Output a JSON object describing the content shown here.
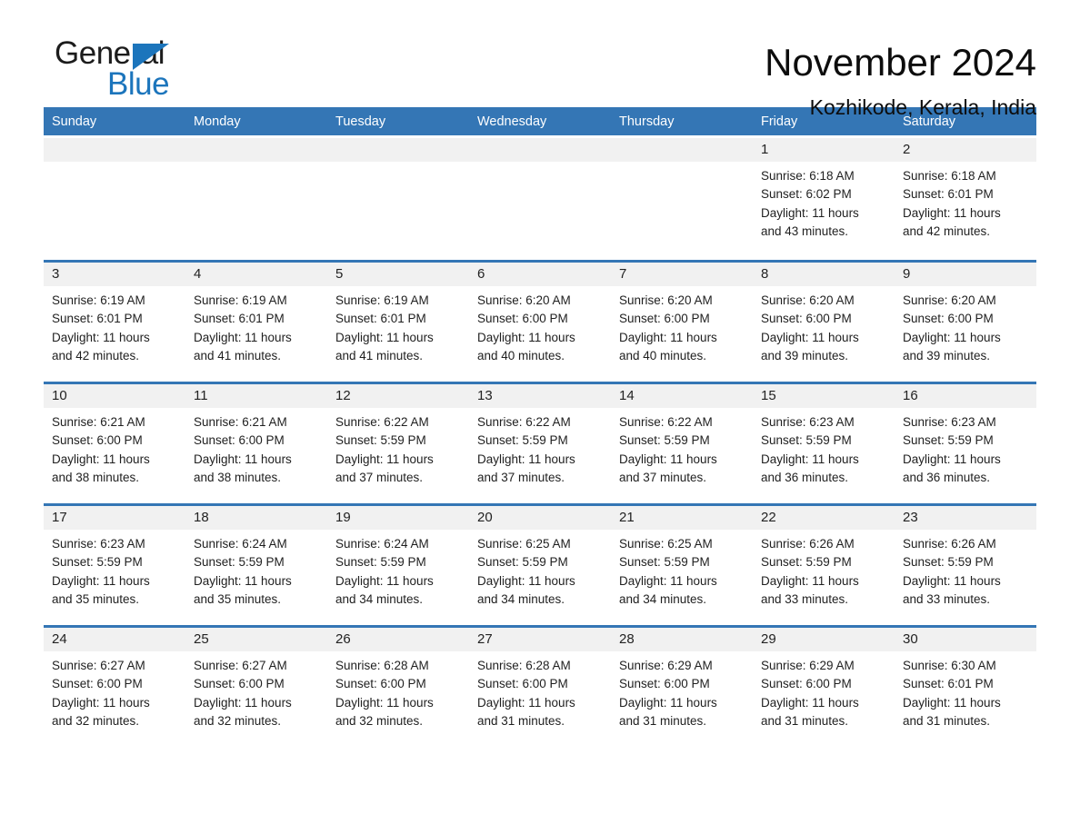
{
  "brand": {
    "name_part1": "General",
    "name_part2": "Blue",
    "accent_color": "#1c75bc"
  },
  "header": {
    "title": "November 2024",
    "location": "Kozhikode, Kerala, India"
  },
  "theme": {
    "header_row_bg": "#3476b5",
    "row_top_border": "#3476b5",
    "date_band_bg": "#f1f1f1",
    "page_bg": "#ffffff"
  },
  "calendar": {
    "weekdays": [
      "Sunday",
      "Monday",
      "Tuesday",
      "Wednesday",
      "Thursday",
      "Friday",
      "Saturday"
    ],
    "weeks": [
      [
        {
          "day": "",
          "empty": true,
          "sunrise": "",
          "sunset": "",
          "daylight_line1": "",
          "daylight_line2": ""
        },
        {
          "day": "",
          "empty": true,
          "sunrise": "",
          "sunset": "",
          "daylight_line1": "",
          "daylight_line2": ""
        },
        {
          "day": "",
          "empty": true,
          "sunrise": "",
          "sunset": "",
          "daylight_line1": "",
          "daylight_line2": ""
        },
        {
          "day": "",
          "empty": true,
          "sunrise": "",
          "sunset": "",
          "daylight_line1": "",
          "daylight_line2": ""
        },
        {
          "day": "",
          "empty": true,
          "sunrise": "",
          "sunset": "",
          "daylight_line1": "",
          "daylight_line2": ""
        },
        {
          "day": "1",
          "empty": false,
          "sunrise": "Sunrise: 6:18 AM",
          "sunset": "Sunset: 6:02 PM",
          "daylight_line1": "Daylight: 11 hours",
          "daylight_line2": "and 43 minutes."
        },
        {
          "day": "2",
          "empty": false,
          "sunrise": "Sunrise: 6:18 AM",
          "sunset": "Sunset: 6:01 PM",
          "daylight_line1": "Daylight: 11 hours",
          "daylight_line2": "and 42 minutes."
        }
      ],
      [
        {
          "day": "3",
          "empty": false,
          "sunrise": "Sunrise: 6:19 AM",
          "sunset": "Sunset: 6:01 PM",
          "daylight_line1": "Daylight: 11 hours",
          "daylight_line2": "and 42 minutes."
        },
        {
          "day": "4",
          "empty": false,
          "sunrise": "Sunrise: 6:19 AM",
          "sunset": "Sunset: 6:01 PM",
          "daylight_line1": "Daylight: 11 hours",
          "daylight_line2": "and 41 minutes."
        },
        {
          "day": "5",
          "empty": false,
          "sunrise": "Sunrise: 6:19 AM",
          "sunset": "Sunset: 6:01 PM",
          "daylight_line1": "Daylight: 11 hours",
          "daylight_line2": "and 41 minutes."
        },
        {
          "day": "6",
          "empty": false,
          "sunrise": "Sunrise: 6:20 AM",
          "sunset": "Sunset: 6:00 PM",
          "daylight_line1": "Daylight: 11 hours",
          "daylight_line2": "and 40 minutes."
        },
        {
          "day": "7",
          "empty": false,
          "sunrise": "Sunrise: 6:20 AM",
          "sunset": "Sunset: 6:00 PM",
          "daylight_line1": "Daylight: 11 hours",
          "daylight_line2": "and 40 minutes."
        },
        {
          "day": "8",
          "empty": false,
          "sunrise": "Sunrise: 6:20 AM",
          "sunset": "Sunset: 6:00 PM",
          "daylight_line1": "Daylight: 11 hours",
          "daylight_line2": "and 39 minutes."
        },
        {
          "day": "9",
          "empty": false,
          "sunrise": "Sunrise: 6:20 AM",
          "sunset": "Sunset: 6:00 PM",
          "daylight_line1": "Daylight: 11 hours",
          "daylight_line2": "and 39 minutes."
        }
      ],
      [
        {
          "day": "10",
          "empty": false,
          "sunrise": "Sunrise: 6:21 AM",
          "sunset": "Sunset: 6:00 PM",
          "daylight_line1": "Daylight: 11 hours",
          "daylight_line2": "and 38 minutes."
        },
        {
          "day": "11",
          "empty": false,
          "sunrise": "Sunrise: 6:21 AM",
          "sunset": "Sunset: 6:00 PM",
          "daylight_line1": "Daylight: 11 hours",
          "daylight_line2": "and 38 minutes."
        },
        {
          "day": "12",
          "empty": false,
          "sunrise": "Sunrise: 6:22 AM",
          "sunset": "Sunset: 5:59 PM",
          "daylight_line1": "Daylight: 11 hours",
          "daylight_line2": "and 37 minutes."
        },
        {
          "day": "13",
          "empty": false,
          "sunrise": "Sunrise: 6:22 AM",
          "sunset": "Sunset: 5:59 PM",
          "daylight_line1": "Daylight: 11 hours",
          "daylight_line2": "and 37 minutes."
        },
        {
          "day": "14",
          "empty": false,
          "sunrise": "Sunrise: 6:22 AM",
          "sunset": "Sunset: 5:59 PM",
          "daylight_line1": "Daylight: 11 hours",
          "daylight_line2": "and 37 minutes."
        },
        {
          "day": "15",
          "empty": false,
          "sunrise": "Sunrise: 6:23 AM",
          "sunset": "Sunset: 5:59 PM",
          "daylight_line1": "Daylight: 11 hours",
          "daylight_line2": "and 36 minutes."
        },
        {
          "day": "16",
          "empty": false,
          "sunrise": "Sunrise: 6:23 AM",
          "sunset": "Sunset: 5:59 PM",
          "daylight_line1": "Daylight: 11 hours",
          "daylight_line2": "and 36 minutes."
        }
      ],
      [
        {
          "day": "17",
          "empty": false,
          "sunrise": "Sunrise: 6:23 AM",
          "sunset": "Sunset: 5:59 PM",
          "daylight_line1": "Daylight: 11 hours",
          "daylight_line2": "and 35 minutes."
        },
        {
          "day": "18",
          "empty": false,
          "sunrise": "Sunrise: 6:24 AM",
          "sunset": "Sunset: 5:59 PM",
          "daylight_line1": "Daylight: 11 hours",
          "daylight_line2": "and 35 minutes."
        },
        {
          "day": "19",
          "empty": false,
          "sunrise": "Sunrise: 6:24 AM",
          "sunset": "Sunset: 5:59 PM",
          "daylight_line1": "Daylight: 11 hours",
          "daylight_line2": "and 34 minutes."
        },
        {
          "day": "20",
          "empty": false,
          "sunrise": "Sunrise: 6:25 AM",
          "sunset": "Sunset: 5:59 PM",
          "daylight_line1": "Daylight: 11 hours",
          "daylight_line2": "and 34 minutes."
        },
        {
          "day": "21",
          "empty": false,
          "sunrise": "Sunrise: 6:25 AM",
          "sunset": "Sunset: 5:59 PM",
          "daylight_line1": "Daylight: 11 hours",
          "daylight_line2": "and 34 minutes."
        },
        {
          "day": "22",
          "empty": false,
          "sunrise": "Sunrise: 6:26 AM",
          "sunset": "Sunset: 5:59 PM",
          "daylight_line1": "Daylight: 11 hours",
          "daylight_line2": "and 33 minutes."
        },
        {
          "day": "23",
          "empty": false,
          "sunrise": "Sunrise: 6:26 AM",
          "sunset": "Sunset: 5:59 PM",
          "daylight_line1": "Daylight: 11 hours",
          "daylight_line2": "and 33 minutes."
        }
      ],
      [
        {
          "day": "24",
          "empty": false,
          "sunrise": "Sunrise: 6:27 AM",
          "sunset": "Sunset: 6:00 PM",
          "daylight_line1": "Daylight: 11 hours",
          "daylight_line2": "and 32 minutes."
        },
        {
          "day": "25",
          "empty": false,
          "sunrise": "Sunrise: 6:27 AM",
          "sunset": "Sunset: 6:00 PM",
          "daylight_line1": "Daylight: 11 hours",
          "daylight_line2": "and 32 minutes."
        },
        {
          "day": "26",
          "empty": false,
          "sunrise": "Sunrise: 6:28 AM",
          "sunset": "Sunset: 6:00 PM",
          "daylight_line1": "Daylight: 11 hours",
          "daylight_line2": "and 32 minutes."
        },
        {
          "day": "27",
          "empty": false,
          "sunrise": "Sunrise: 6:28 AM",
          "sunset": "Sunset: 6:00 PM",
          "daylight_line1": "Daylight: 11 hours",
          "daylight_line2": "and 31 minutes."
        },
        {
          "day": "28",
          "empty": false,
          "sunrise": "Sunrise: 6:29 AM",
          "sunset": "Sunset: 6:00 PM",
          "daylight_line1": "Daylight: 11 hours",
          "daylight_line2": "and 31 minutes."
        },
        {
          "day": "29",
          "empty": false,
          "sunrise": "Sunrise: 6:29 AM",
          "sunset": "Sunset: 6:00 PM",
          "daylight_line1": "Daylight: 11 hours",
          "daylight_line2": "and 31 minutes."
        },
        {
          "day": "30",
          "empty": false,
          "sunrise": "Sunrise: 6:30 AM",
          "sunset": "Sunset: 6:01 PM",
          "daylight_line1": "Daylight: 11 hours",
          "daylight_line2": "and 31 minutes."
        }
      ]
    ]
  }
}
